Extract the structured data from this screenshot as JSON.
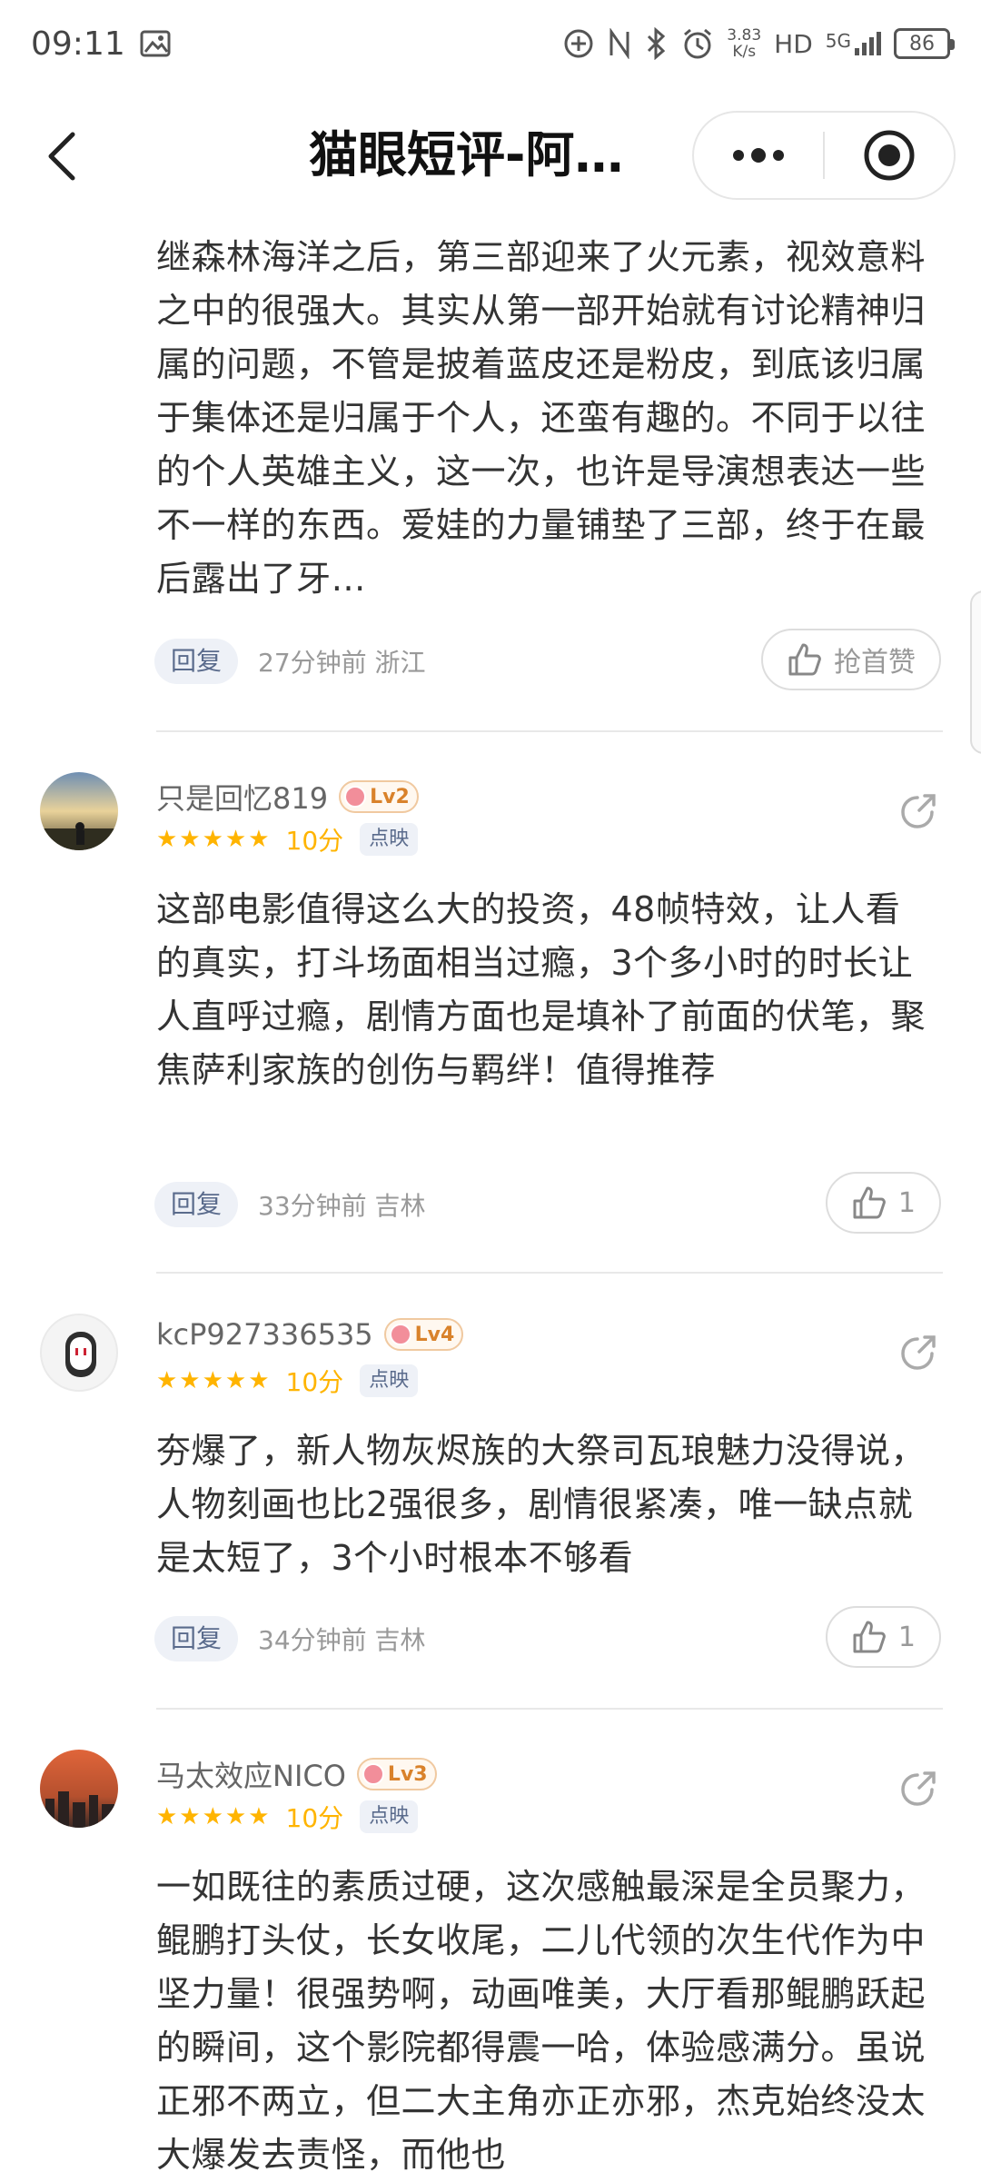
{
  "status": {
    "time": "09:11",
    "net_speed_value": "3.83",
    "net_speed_unit": "K/s",
    "hd": "HD",
    "signal": "5G",
    "battery": "86"
  },
  "nav": {
    "title": "猫眼短评-阿…"
  },
  "top_comment": {
    "text": "继森林海洋之后，第三部迎来了火元素，视效意料之中的很强大。其实从第一部开始就有讨论精神归属的问题，不管是披着蓝皮还是粉皮，到底该归属于集体还是归属于个人，还蛮有趣的。不同于以往的个人英雄主义，这一次，也许是导演想表达一些不一样的东西。爱娃的力量铺垫了三部，终于在最后露出了牙…",
    "reply": "回复",
    "meta": "27分钟前 浙江",
    "like_label": "抢首赞"
  },
  "reviews": [
    {
      "username": "只是回忆819",
      "level": "Lv2",
      "stars": "★★★★★",
      "score": "10分",
      "tag": "点映",
      "text": "这部电影值得这么大的投资，48帧特效，让人看的真实，打斗场面相当过瘾，3个多小时的时长让人直呼过瘾，剧情方面也是填补了前面的伏笔，聚焦萨利家族的创伤与羁绊！值得推荐",
      "reply": "回复",
      "meta": "33分钟前 吉林",
      "likes": "1"
    },
    {
      "username": "kcP927336535",
      "level": "Lv4",
      "stars": "★★★★★",
      "score": "10分",
      "tag": "点映",
      "text": "夯爆了，新人物灰烬族的大祭司瓦琅魅力没得说，人物刻画也比2强很多，剧情很紧凑，唯一缺点就是太短了，3个小时根本不够看",
      "reply": "回复",
      "meta": "34分钟前 吉林",
      "likes": "1"
    },
    {
      "username": "马太效应NICO",
      "level": "Lv3",
      "stars": "★★★★★",
      "score": "10分",
      "tag": "点映",
      "text": "一如既往的素质过硬，这次感触最深是全员聚力，鲲鹏打头仗，长女收尾，二儿代领的次生代作为中坚力量！很强势啊，动画唯美，大厅看那鲲鹏跃起的瞬间，这个影院都得震一哈，体验感满分。虽说正邪不两立，但二大主角亦正亦邪，杰克始终没太大爆发去责怪，而他也"
    }
  ],
  "colors": {
    "star": "#ffb400",
    "reply_bg": "#eef1f7",
    "reply_text": "#5a6b8c",
    "meta": "#999999"
  }
}
